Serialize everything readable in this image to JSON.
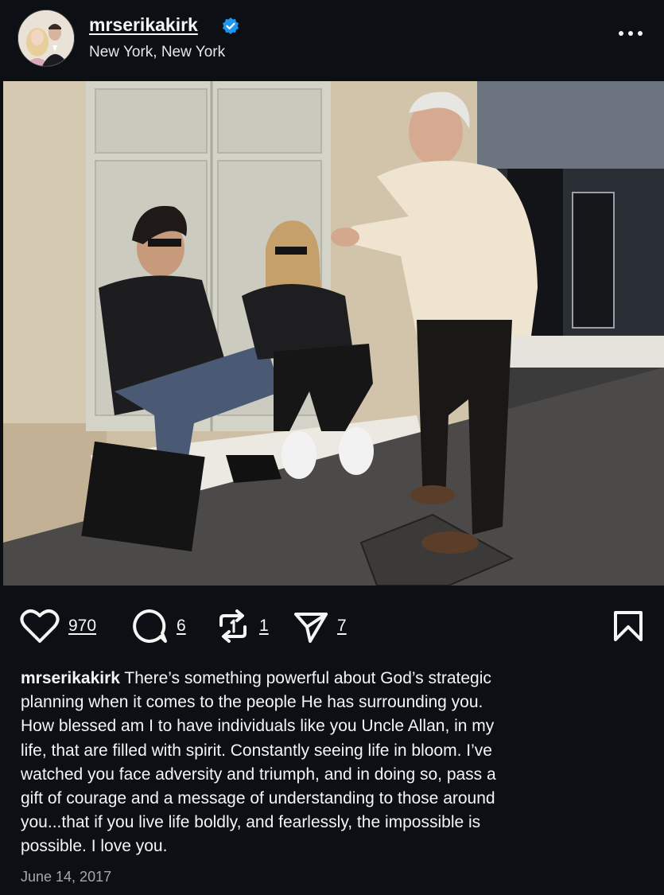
{
  "post": {
    "username": "mrserikakirk",
    "location": "New York, New York",
    "verified": true,
    "photo_alt": "",
    "icons": {
      "more": "more-options-icon",
      "like": "heart-icon",
      "comment": "comment-bubble-icon",
      "repost": "repost-icon",
      "share": "send-icon",
      "save": "bookmark-icon",
      "verified": "verified-badge-icon"
    },
    "actions": {
      "likes": "970",
      "comments": "6",
      "reposts": "1",
      "shares": "7"
    },
    "caption_lines": [
      "There’s something powerful about God’s strategic",
      "planning when it comes to the people He has surrounding you.",
      "How blessed am I to have individuals like you Uncle Allan, in my",
      "life, that are filled with spirit. Constantly seeing life in bloom. I’ve",
      "watched you face adversity and triumph, and in doing so, pass a",
      "gift of courage and a message of understanding to those around",
      "you...that if you live life boldly, and fearlessly, the impossible is",
      "possible. I love you."
    ],
    "date": "June 14, 2017"
  },
  "colors": {
    "background": "#0c1014",
    "text": "#f5f5f5",
    "secondary_text": "#a8a8a8",
    "verified_blue": "#1c96f0"
  }
}
